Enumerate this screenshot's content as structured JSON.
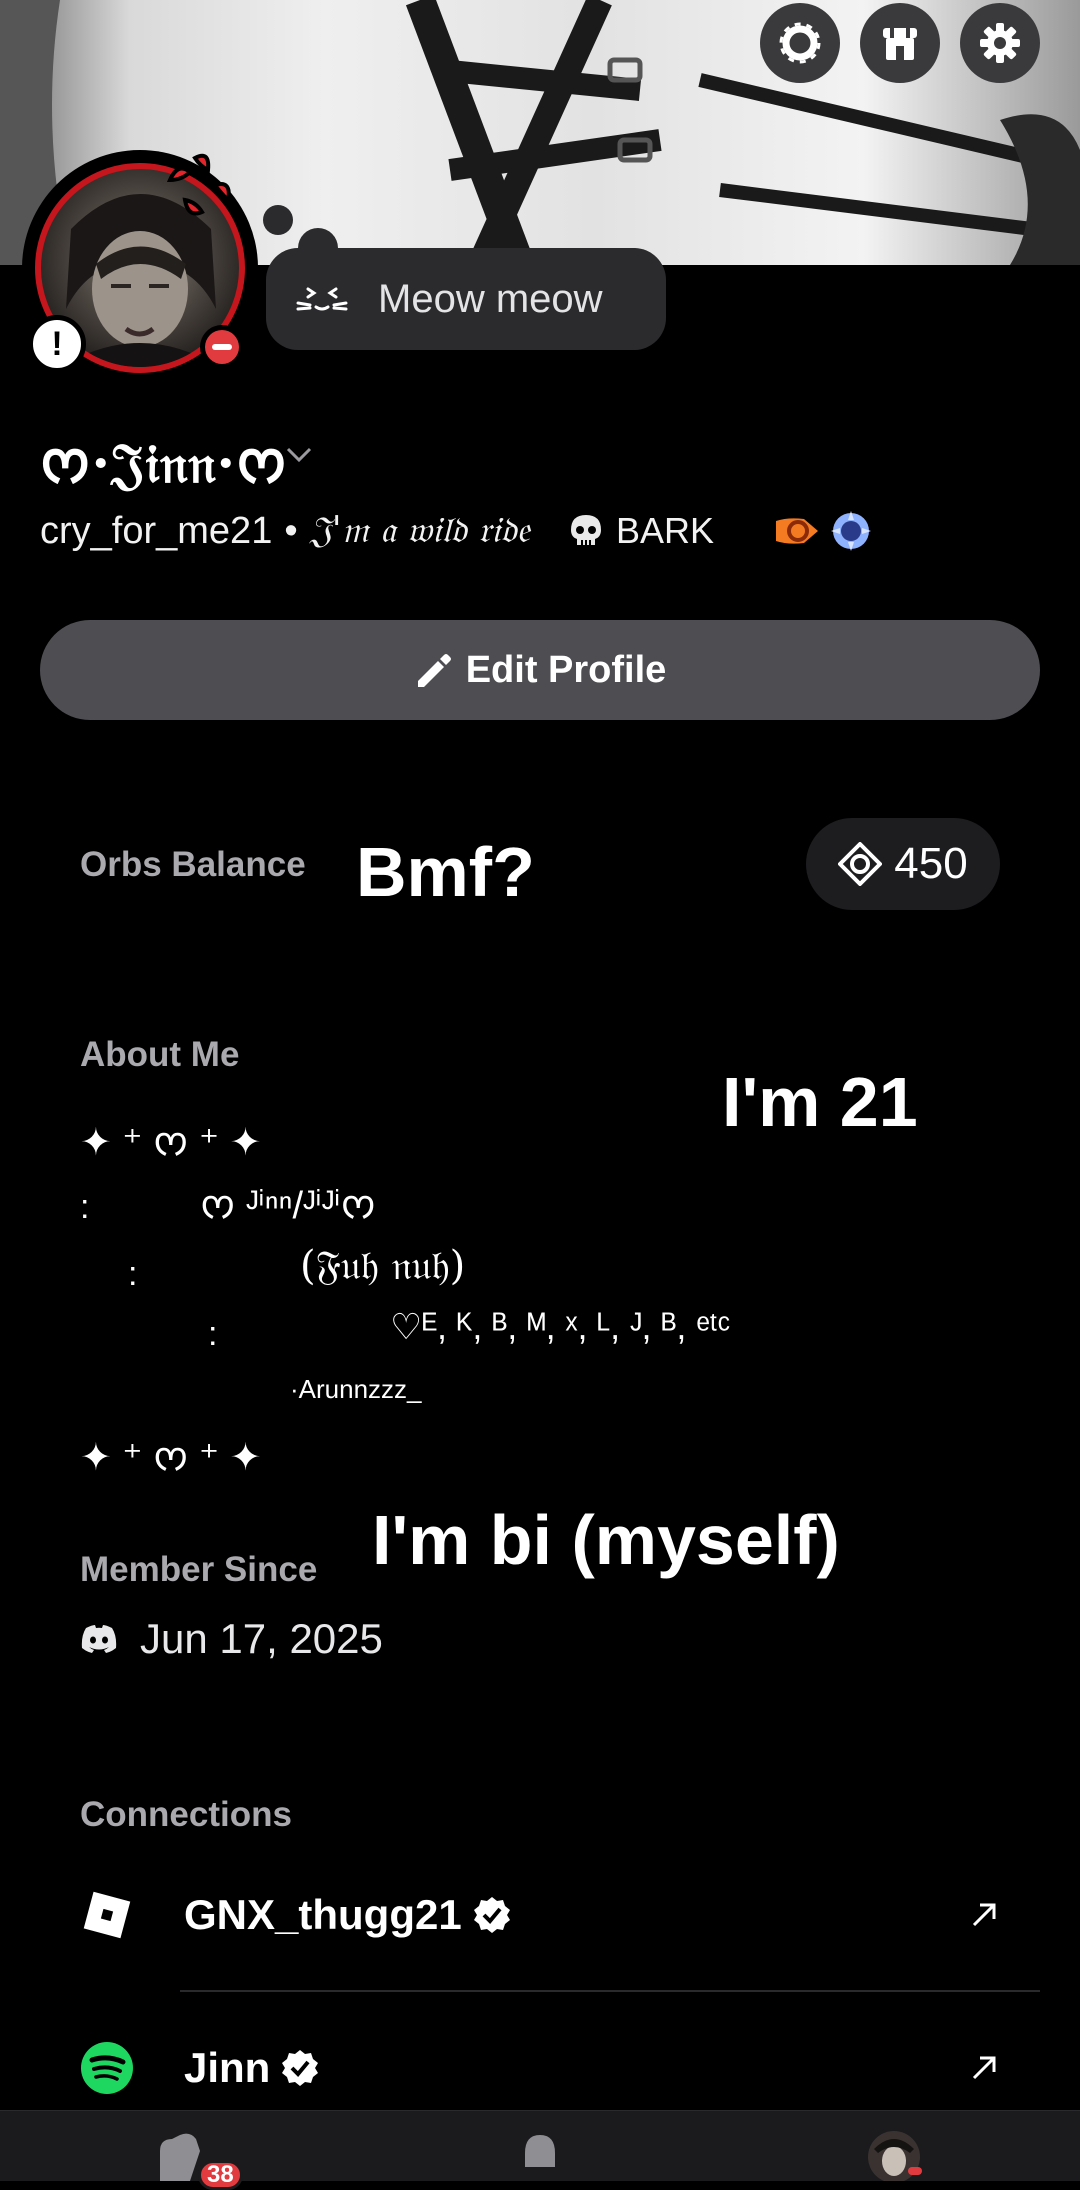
{
  "profile": {
    "status_text": "Meow meow",
    "display_name": "ᰔ·𝔍𝔦𝔫𝔫·ᰔ",
    "username": "cry_for_me21",
    "separator": "•",
    "pronouns": "𝔍'𝔪 𝔞 𝔴𝔦𝔩𝔡 𝔯𝔦𝔡𝔢",
    "server_tag": "BARK"
  },
  "actions": {
    "edit_profile": "Edit Profile"
  },
  "orbs": {
    "label": "Orbs Balance",
    "value": "450"
  },
  "overlays": {
    "bmf": "Bmf?",
    "age": "I'm 21",
    "bi": "I'm bi (myself)"
  },
  "about": {
    "label": "About Me",
    "lines": [
      "✦ ⁺ ᰔ ⁺ ✦",
      ":",
      "ᰔ ᴶⁱⁿⁿ/ᴶⁱᴶⁱᰔ",
      ":",
      "(𝔉𝔲𝔥 𝔫𝔲𝔥)",
      ":",
      "♡ᴱ, ᴷ, ᴮ, ᴹ, ˣ, ᴸ, ᴶ, ᴮ, ᵉᵗᶜ",
      "·Arunnzzz_",
      "✦ ⁺ ᰔ ⁺ ✦"
    ]
  },
  "member_since": {
    "label": "Member Since",
    "date": "Jun 17, 2025"
  },
  "connections": {
    "label": "Connections",
    "items": [
      {
        "service": "roblox",
        "name": "GNX_thugg21"
      },
      {
        "service": "spotify",
        "name": "Jinn"
      }
    ]
  },
  "nav": {
    "badge_count": "38"
  },
  "colors": {
    "background": "#000000",
    "accent_red": "#e23b3f",
    "spotify": "#1ed760",
    "button_gray": "#4e4e52"
  },
  "icons": [
    "nitro-icon",
    "shop-icon",
    "gear-icon",
    "dnd-status-icon",
    "alert-icon",
    "cat-face-icon",
    "chevron-down-icon",
    "skull-icon",
    "boost-badge-icon",
    "quest-badge-icon",
    "pencil-icon",
    "orb-icon",
    "discord-icon",
    "roblox-icon",
    "spotify-icon",
    "verified-icon",
    "external-link-icon",
    "friends-icon",
    "bell-icon",
    "profile-avatar-icon"
  ]
}
